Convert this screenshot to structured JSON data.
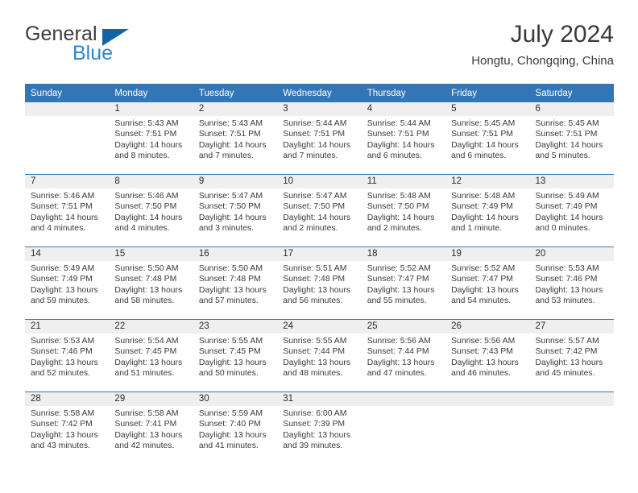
{
  "brand": {
    "name_part1": "General",
    "name_part2": "Blue",
    "logo_icon": "blue-triangle-flag"
  },
  "header": {
    "month_year": "July 2024",
    "location": "Hongtu, Chongqing, China"
  },
  "calendar": {
    "weekday_headers": [
      "Sunday",
      "Monday",
      "Tuesday",
      "Wednesday",
      "Thursday",
      "Friday",
      "Saturday"
    ],
    "accent_color": "#3276b8",
    "daynum_band_color": "#efefef",
    "weeks": [
      [
        {
          "day": "",
          "sunrise": "",
          "sunset": "",
          "daylight_line1": "",
          "daylight_line2": ""
        },
        {
          "day": "1",
          "sunrise": "Sunrise: 5:43 AM",
          "sunset": "Sunset: 7:51 PM",
          "daylight_line1": "Daylight: 14 hours",
          "daylight_line2": "and 8 minutes."
        },
        {
          "day": "2",
          "sunrise": "Sunrise: 5:43 AM",
          "sunset": "Sunset: 7:51 PM",
          "daylight_line1": "Daylight: 14 hours",
          "daylight_line2": "and 7 minutes."
        },
        {
          "day": "3",
          "sunrise": "Sunrise: 5:44 AM",
          "sunset": "Sunset: 7:51 PM",
          "daylight_line1": "Daylight: 14 hours",
          "daylight_line2": "and 7 minutes."
        },
        {
          "day": "4",
          "sunrise": "Sunrise: 5:44 AM",
          "sunset": "Sunset: 7:51 PM",
          "daylight_line1": "Daylight: 14 hours",
          "daylight_line2": "and 6 minutes."
        },
        {
          "day": "5",
          "sunrise": "Sunrise: 5:45 AM",
          "sunset": "Sunset: 7:51 PM",
          "daylight_line1": "Daylight: 14 hours",
          "daylight_line2": "and 6 minutes."
        },
        {
          "day": "6",
          "sunrise": "Sunrise: 5:45 AM",
          "sunset": "Sunset: 7:51 PM",
          "daylight_line1": "Daylight: 14 hours",
          "daylight_line2": "and 5 minutes."
        }
      ],
      [
        {
          "day": "7",
          "sunrise": "Sunrise: 5:46 AM",
          "sunset": "Sunset: 7:51 PM",
          "daylight_line1": "Daylight: 14 hours",
          "daylight_line2": "and 4 minutes."
        },
        {
          "day": "8",
          "sunrise": "Sunrise: 5:46 AM",
          "sunset": "Sunset: 7:50 PM",
          "daylight_line1": "Daylight: 14 hours",
          "daylight_line2": "and 4 minutes."
        },
        {
          "day": "9",
          "sunrise": "Sunrise: 5:47 AM",
          "sunset": "Sunset: 7:50 PM",
          "daylight_line1": "Daylight: 14 hours",
          "daylight_line2": "and 3 minutes."
        },
        {
          "day": "10",
          "sunrise": "Sunrise: 5:47 AM",
          "sunset": "Sunset: 7:50 PM",
          "daylight_line1": "Daylight: 14 hours",
          "daylight_line2": "and 2 minutes."
        },
        {
          "day": "11",
          "sunrise": "Sunrise: 5:48 AM",
          "sunset": "Sunset: 7:50 PM",
          "daylight_line1": "Daylight: 14 hours",
          "daylight_line2": "and 2 minutes."
        },
        {
          "day": "12",
          "sunrise": "Sunrise: 5:48 AM",
          "sunset": "Sunset: 7:49 PM",
          "daylight_line1": "Daylight: 14 hours",
          "daylight_line2": "and 1 minute."
        },
        {
          "day": "13",
          "sunrise": "Sunrise: 5:49 AM",
          "sunset": "Sunset: 7:49 PM",
          "daylight_line1": "Daylight: 14 hours",
          "daylight_line2": "and 0 minutes."
        }
      ],
      [
        {
          "day": "14",
          "sunrise": "Sunrise: 5:49 AM",
          "sunset": "Sunset: 7:49 PM",
          "daylight_line1": "Daylight: 13 hours",
          "daylight_line2": "and 59 minutes."
        },
        {
          "day": "15",
          "sunrise": "Sunrise: 5:50 AM",
          "sunset": "Sunset: 7:48 PM",
          "daylight_line1": "Daylight: 13 hours",
          "daylight_line2": "and 58 minutes."
        },
        {
          "day": "16",
          "sunrise": "Sunrise: 5:50 AM",
          "sunset": "Sunset: 7:48 PM",
          "daylight_line1": "Daylight: 13 hours",
          "daylight_line2": "and 57 minutes."
        },
        {
          "day": "17",
          "sunrise": "Sunrise: 5:51 AM",
          "sunset": "Sunset: 7:48 PM",
          "daylight_line1": "Daylight: 13 hours",
          "daylight_line2": "and 56 minutes."
        },
        {
          "day": "18",
          "sunrise": "Sunrise: 5:52 AM",
          "sunset": "Sunset: 7:47 PM",
          "daylight_line1": "Daylight: 13 hours",
          "daylight_line2": "and 55 minutes."
        },
        {
          "day": "19",
          "sunrise": "Sunrise: 5:52 AM",
          "sunset": "Sunset: 7:47 PM",
          "daylight_line1": "Daylight: 13 hours",
          "daylight_line2": "and 54 minutes."
        },
        {
          "day": "20",
          "sunrise": "Sunrise: 5:53 AM",
          "sunset": "Sunset: 7:46 PM",
          "daylight_line1": "Daylight: 13 hours",
          "daylight_line2": "and 53 minutes."
        }
      ],
      [
        {
          "day": "21",
          "sunrise": "Sunrise: 5:53 AM",
          "sunset": "Sunset: 7:46 PM",
          "daylight_line1": "Daylight: 13 hours",
          "daylight_line2": "and 52 minutes."
        },
        {
          "day": "22",
          "sunrise": "Sunrise: 5:54 AM",
          "sunset": "Sunset: 7:45 PM",
          "daylight_line1": "Daylight: 13 hours",
          "daylight_line2": "and 51 minutes."
        },
        {
          "day": "23",
          "sunrise": "Sunrise: 5:55 AM",
          "sunset": "Sunset: 7:45 PM",
          "daylight_line1": "Daylight: 13 hours",
          "daylight_line2": "and 50 minutes."
        },
        {
          "day": "24",
          "sunrise": "Sunrise: 5:55 AM",
          "sunset": "Sunset: 7:44 PM",
          "daylight_line1": "Daylight: 13 hours",
          "daylight_line2": "and 48 minutes."
        },
        {
          "day": "25",
          "sunrise": "Sunrise: 5:56 AM",
          "sunset": "Sunset: 7:44 PM",
          "daylight_line1": "Daylight: 13 hours",
          "daylight_line2": "and 47 minutes."
        },
        {
          "day": "26",
          "sunrise": "Sunrise: 5:56 AM",
          "sunset": "Sunset: 7:43 PM",
          "daylight_line1": "Daylight: 13 hours",
          "daylight_line2": "and 46 minutes."
        },
        {
          "day": "27",
          "sunrise": "Sunrise: 5:57 AM",
          "sunset": "Sunset: 7:42 PM",
          "daylight_line1": "Daylight: 13 hours",
          "daylight_line2": "and 45 minutes."
        }
      ],
      [
        {
          "day": "28",
          "sunrise": "Sunrise: 5:58 AM",
          "sunset": "Sunset: 7:42 PM",
          "daylight_line1": "Daylight: 13 hours",
          "daylight_line2": "and 43 minutes."
        },
        {
          "day": "29",
          "sunrise": "Sunrise: 5:58 AM",
          "sunset": "Sunset: 7:41 PM",
          "daylight_line1": "Daylight: 13 hours",
          "daylight_line2": "and 42 minutes."
        },
        {
          "day": "30",
          "sunrise": "Sunrise: 5:59 AM",
          "sunset": "Sunset: 7:40 PM",
          "daylight_line1": "Daylight: 13 hours",
          "daylight_line2": "and 41 minutes."
        },
        {
          "day": "31",
          "sunrise": "Sunrise: 6:00 AM",
          "sunset": "Sunset: 7:39 PM",
          "daylight_line1": "Daylight: 13 hours",
          "daylight_line2": "and 39 minutes."
        },
        {
          "day": "",
          "sunrise": "",
          "sunset": "",
          "daylight_line1": "",
          "daylight_line2": ""
        },
        {
          "day": "",
          "sunrise": "",
          "sunset": "",
          "daylight_line1": "",
          "daylight_line2": ""
        },
        {
          "day": "",
          "sunrise": "",
          "sunset": "",
          "daylight_line1": "",
          "daylight_line2": ""
        }
      ]
    ]
  }
}
